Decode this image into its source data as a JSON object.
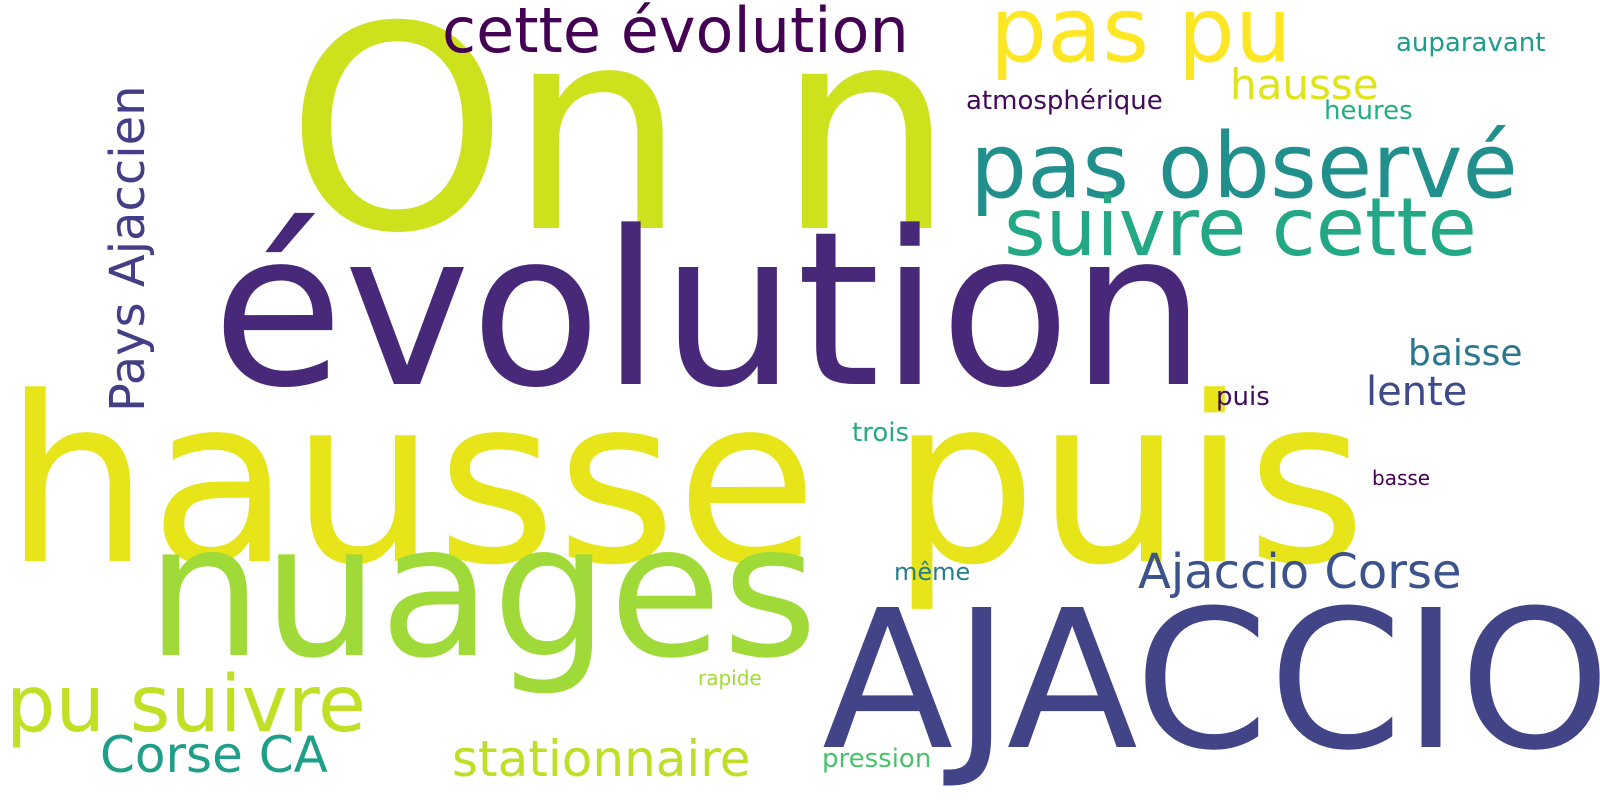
{
  "word_cloud": {
    "words": [
      {
        "text": "On n",
        "color": "#cde11d"
      },
      {
        "text": "évolution",
        "color": "#482878"
      },
      {
        "text": "hausse puis",
        "color": "#e7e419"
      },
      {
        "text": "nuages",
        "color": "#a0da39"
      },
      {
        "text": "AJACCIO",
        "color": "#414487"
      },
      {
        "text": "pas observé",
        "color": "#21908d"
      },
      {
        "text": "suivre cette",
        "color": "#22a884"
      },
      {
        "text": "pas pu",
        "color": "#fde725"
      },
      {
        "text": "cette évolution",
        "color": "#440154"
      },
      {
        "text": "pu suivre",
        "color": "#c0df25"
      },
      {
        "text": "Pays Ajaccien",
        "color": "#433e85"
      },
      {
        "text": "Ajaccio Corse",
        "color": "#3b528b"
      },
      {
        "text": "stationnaire",
        "color": "#bddf26"
      },
      {
        "text": "Corse CA",
        "color": "#1f9e89"
      },
      {
        "text": "hausse",
        "color": "#dfe318"
      },
      {
        "text": "baisse",
        "color": "#2a788e"
      },
      {
        "text": "lente",
        "color": "#3e4a89"
      },
      {
        "text": "atmosphérique",
        "color": "#46085c"
      },
      {
        "text": "auparavant",
        "color": "#1e9c89"
      },
      {
        "text": "heures",
        "color": "#26ad81"
      },
      {
        "text": "puis",
        "color": "#450a5c"
      },
      {
        "text": "trois",
        "color": "#25ab82"
      },
      {
        "text": "basse",
        "color": "#440154"
      },
      {
        "text": "même",
        "color": "#287d8e"
      },
      {
        "text": "rapide",
        "color": "#a2da37"
      },
      {
        "text": "pression",
        "color": "#4ac16d"
      }
    ]
  }
}
